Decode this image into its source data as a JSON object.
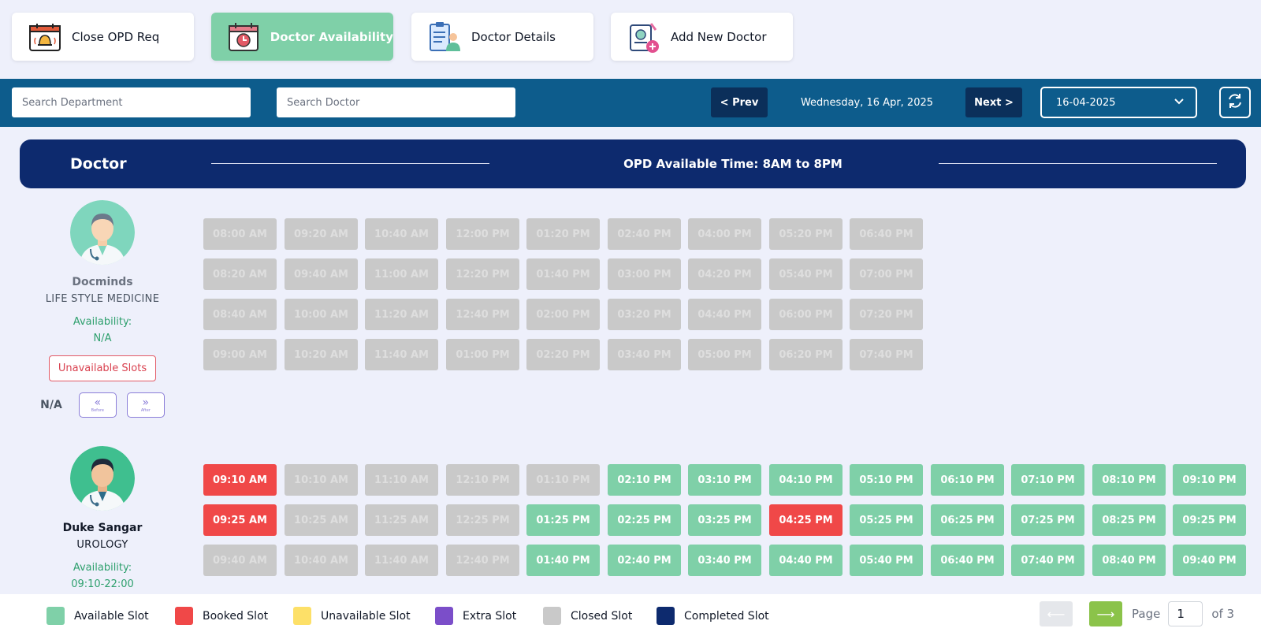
{
  "nav": [
    {
      "label": "Close OPD Req",
      "icon": "alarm-calendar-icon",
      "active": false
    },
    {
      "label": "Doctor Availability",
      "icon": "calendar-clock-icon",
      "active": true
    },
    {
      "label": "Doctor Details",
      "icon": "clipboard-doctor-icon",
      "active": false
    },
    {
      "label": "Add New Doctor",
      "icon": "add-doctor-icon",
      "active": false
    }
  ],
  "toolbar": {
    "search_department_placeholder": "Search Department",
    "search_doctor_placeholder": "Search Doctor",
    "prev_label": "< Prev",
    "current_date_text": "Wednesday, 16 Apr, 2025",
    "next_label": "Next >",
    "date_value": "16-04-2025"
  },
  "header": {
    "doctor_col": "Doctor",
    "opd_time": "OPD Available Time: 8AM to 8PM"
  },
  "doctors": [
    {
      "name": "Docminds",
      "department": "LIFE STYLE MEDICINE",
      "availability_label": "Availability:",
      "availability_value": "N/A",
      "unavailable_slots_label": "Unavailable Slots",
      "nav_status": "N/A",
      "before_label": "Before",
      "after_label": "After",
      "slot_columns": [
        [
          {
            "time": "08:00 AM",
            "status": "closed"
          },
          {
            "time": "08:20 AM",
            "status": "closed"
          },
          {
            "time": "08:40 AM",
            "status": "closed"
          },
          {
            "time": "09:00 AM",
            "status": "closed"
          }
        ],
        [
          {
            "time": "09:20 AM",
            "status": "closed"
          },
          {
            "time": "09:40 AM",
            "status": "closed"
          },
          {
            "time": "10:00 AM",
            "status": "closed"
          },
          {
            "time": "10:20 AM",
            "status": "closed"
          }
        ],
        [
          {
            "time": "10:40 AM",
            "status": "closed"
          },
          {
            "time": "11:00 AM",
            "status": "closed"
          },
          {
            "time": "11:20 AM",
            "status": "closed"
          },
          {
            "time": "11:40 AM",
            "status": "closed"
          }
        ],
        [
          {
            "time": "12:00 PM",
            "status": "closed"
          },
          {
            "time": "12:20 PM",
            "status": "closed"
          },
          {
            "time": "12:40 PM",
            "status": "closed"
          },
          {
            "time": "01:00 PM",
            "status": "closed"
          }
        ],
        [
          {
            "time": "01:20 PM",
            "status": "closed"
          },
          {
            "time": "01:40 PM",
            "status": "closed"
          },
          {
            "time": "02:00 PM",
            "status": "closed"
          },
          {
            "time": "02:20 PM",
            "status": "closed"
          }
        ],
        [
          {
            "time": "02:40 PM",
            "status": "closed"
          },
          {
            "time": "03:00 PM",
            "status": "closed"
          },
          {
            "time": "03:20 PM",
            "status": "closed"
          },
          {
            "time": "03:40 PM",
            "status": "closed"
          }
        ],
        [
          {
            "time": "04:00 PM",
            "status": "closed"
          },
          {
            "time": "04:20 PM",
            "status": "closed"
          },
          {
            "time": "04:40 PM",
            "status": "closed"
          },
          {
            "time": "05:00 PM",
            "status": "closed"
          }
        ],
        [
          {
            "time": "05:20 PM",
            "status": "closed"
          },
          {
            "time": "05:40 PM",
            "status": "closed"
          },
          {
            "time": "06:00 PM",
            "status": "closed"
          },
          {
            "time": "06:20 PM",
            "status": "closed"
          }
        ],
        [
          {
            "time": "06:40 PM",
            "status": "closed"
          },
          {
            "time": "07:00 PM",
            "status": "closed"
          },
          {
            "time": "07:20 PM",
            "status": "closed"
          },
          {
            "time": "07:40 PM",
            "status": "closed"
          }
        ]
      ]
    },
    {
      "name": "Duke Sangar",
      "department": "UROLOGY",
      "availability_label": "Availability:",
      "availability_value": "09:10-22:00",
      "slot_columns": [
        [
          {
            "time": "09:10 AM",
            "status": "booked"
          },
          {
            "time": "09:25 AM",
            "status": "booked"
          },
          {
            "time": "09:40 AM",
            "status": "closed"
          }
        ],
        [
          {
            "time": "10:10 AM",
            "status": "closed"
          },
          {
            "time": "10:25 AM",
            "status": "closed"
          },
          {
            "time": "10:40 AM",
            "status": "closed"
          }
        ],
        [
          {
            "time": "11:10 AM",
            "status": "closed"
          },
          {
            "time": "11:25 AM",
            "status": "closed"
          },
          {
            "time": "11:40 AM",
            "status": "closed"
          }
        ],
        [
          {
            "time": "12:10 PM",
            "status": "closed"
          },
          {
            "time": "12:25 PM",
            "status": "closed"
          },
          {
            "time": "12:40 PM",
            "status": "closed"
          }
        ],
        [
          {
            "time": "01:10 PM",
            "status": "closed"
          },
          {
            "time": "01:25 PM",
            "status": "available"
          },
          {
            "time": "01:40 PM",
            "status": "available"
          }
        ],
        [
          {
            "time": "02:10 PM",
            "status": "available"
          },
          {
            "time": "02:25 PM",
            "status": "available"
          },
          {
            "time": "02:40 PM",
            "status": "available"
          }
        ],
        [
          {
            "time": "03:10 PM",
            "status": "available"
          },
          {
            "time": "03:25 PM",
            "status": "available"
          },
          {
            "time": "03:40 PM",
            "status": "available"
          }
        ],
        [
          {
            "time": "04:10 PM",
            "status": "available"
          },
          {
            "time": "04:25 PM",
            "status": "booked"
          },
          {
            "time": "04:40 PM",
            "status": "available"
          }
        ],
        [
          {
            "time": "05:10 PM",
            "status": "available"
          },
          {
            "time": "05:25 PM",
            "status": "available"
          },
          {
            "time": "05:40 PM",
            "status": "available"
          }
        ],
        [
          {
            "time": "06:10 PM",
            "status": "available"
          },
          {
            "time": "06:25 PM",
            "status": "available"
          },
          {
            "time": "06:40 PM",
            "status": "available"
          }
        ],
        [
          {
            "time": "07:10 PM",
            "status": "available"
          },
          {
            "time": "07:25 PM",
            "status": "available"
          },
          {
            "time": "07:40 PM",
            "status": "available"
          }
        ],
        [
          {
            "time": "08:10 PM",
            "status": "available"
          },
          {
            "time": "08:25 PM",
            "status": "available"
          },
          {
            "time": "08:40 PM",
            "status": "available"
          }
        ],
        [
          {
            "time": "09:10 PM",
            "status": "available"
          },
          {
            "time": "09:25 PM",
            "status": "available"
          },
          {
            "time": "09:40 PM",
            "status": "available"
          }
        ]
      ]
    }
  ],
  "legend": [
    {
      "label": "Available Slot",
      "color": "#7fd0a8"
    },
    {
      "label": "Booked Slot",
      "color": "#f04848"
    },
    {
      "label": "Unavailable Slot",
      "color": "#fde068"
    },
    {
      "label": "Extra Slot",
      "color": "#7b4ec9"
    },
    {
      "label": "Closed Slot",
      "color": "#c9c9c9"
    },
    {
      "label": "Completed Slot",
      "color": "#0d2a6e"
    }
  ],
  "pagination": {
    "page_label": "Page",
    "current_page": "1",
    "of_label": "of 3",
    "prev_arrow": "⟵",
    "next_arrow": "⟶"
  }
}
